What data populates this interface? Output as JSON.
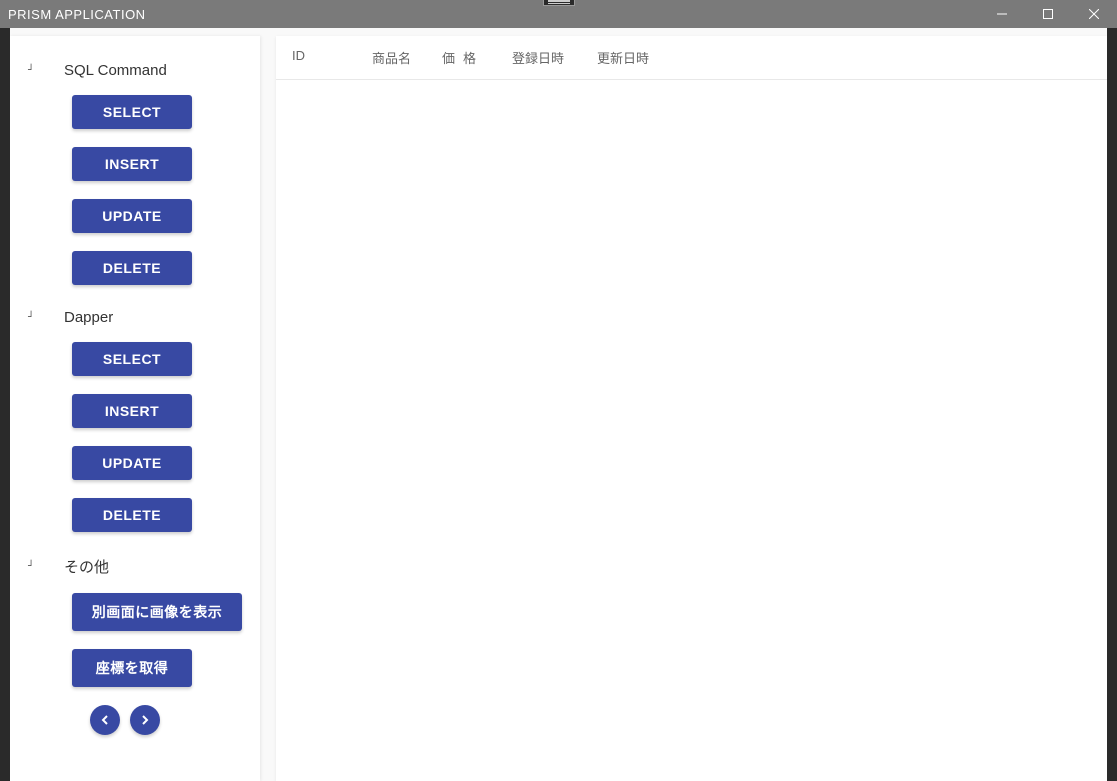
{
  "window": {
    "title": "PRISM APPLICATION"
  },
  "sidebar": {
    "sections": [
      {
        "title": "SQL Command",
        "buttons": [
          {
            "label": "SELECT"
          },
          {
            "label": "INSERT"
          },
          {
            "label": "UPDATE"
          },
          {
            "label": "DELETE"
          }
        ]
      },
      {
        "title": "Dapper",
        "buttons": [
          {
            "label": "SELECT"
          },
          {
            "label": "INSERT"
          },
          {
            "label": "UPDATE"
          },
          {
            "label": "DELETE"
          }
        ]
      },
      {
        "title": "その他",
        "buttons": [
          {
            "label": "別画面に画像を表示"
          },
          {
            "label": "座標を取得"
          }
        ]
      }
    ]
  },
  "table": {
    "columns": {
      "id": "ID",
      "name": "商品名",
      "price": "価格",
      "created": "登録日時",
      "updated": "更新日時"
    },
    "rows": []
  }
}
